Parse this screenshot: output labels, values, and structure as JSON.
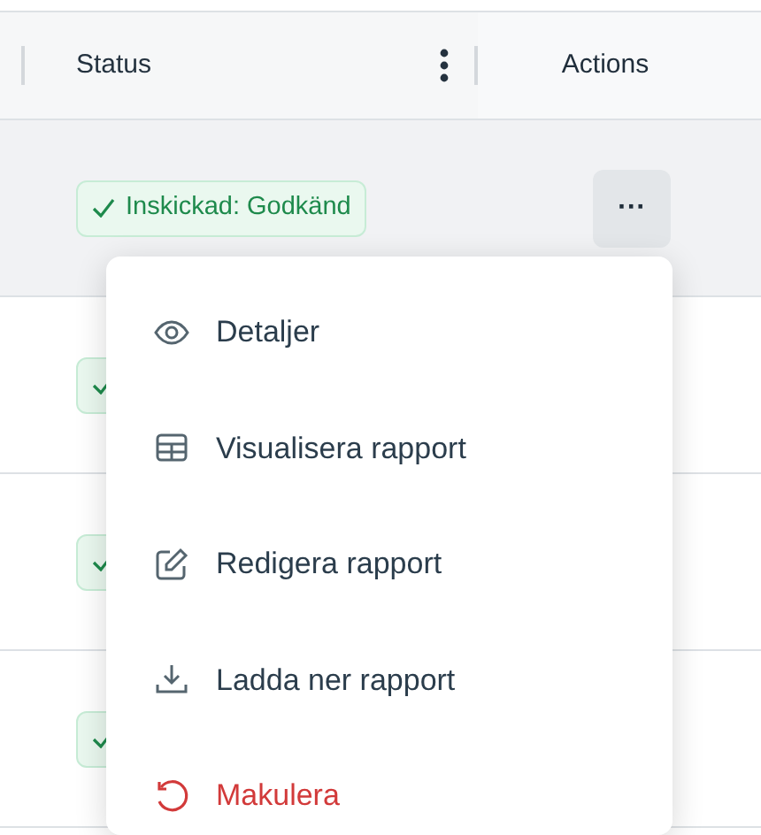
{
  "table": {
    "columns": [
      {
        "label": "Status",
        "kind": "menu"
      },
      {
        "label": "Actions",
        "kind": "plain"
      }
    ],
    "rows": [
      {
        "status": "Inskickad: Godkänd",
        "hovered": true
      },
      {
        "hovered": false
      },
      {
        "hovered": false
      },
      {
        "hovered": false
      }
    ]
  },
  "actions_button": {
    "label": "···"
  },
  "menu": {
    "items": [
      {
        "label": "Detaljer",
        "kind": "eye",
        "danger": false
      },
      {
        "label": "Visualisera rapport",
        "kind": "table",
        "danger": false
      },
      {
        "label": "Redigera rapport",
        "kind": "edit",
        "danger": false
      },
      {
        "label": "Ladda ner rapport",
        "kind": "download",
        "danger": false
      },
      {
        "label": "Makulera",
        "kind": "undo",
        "danger": true
      }
    ]
  }
}
